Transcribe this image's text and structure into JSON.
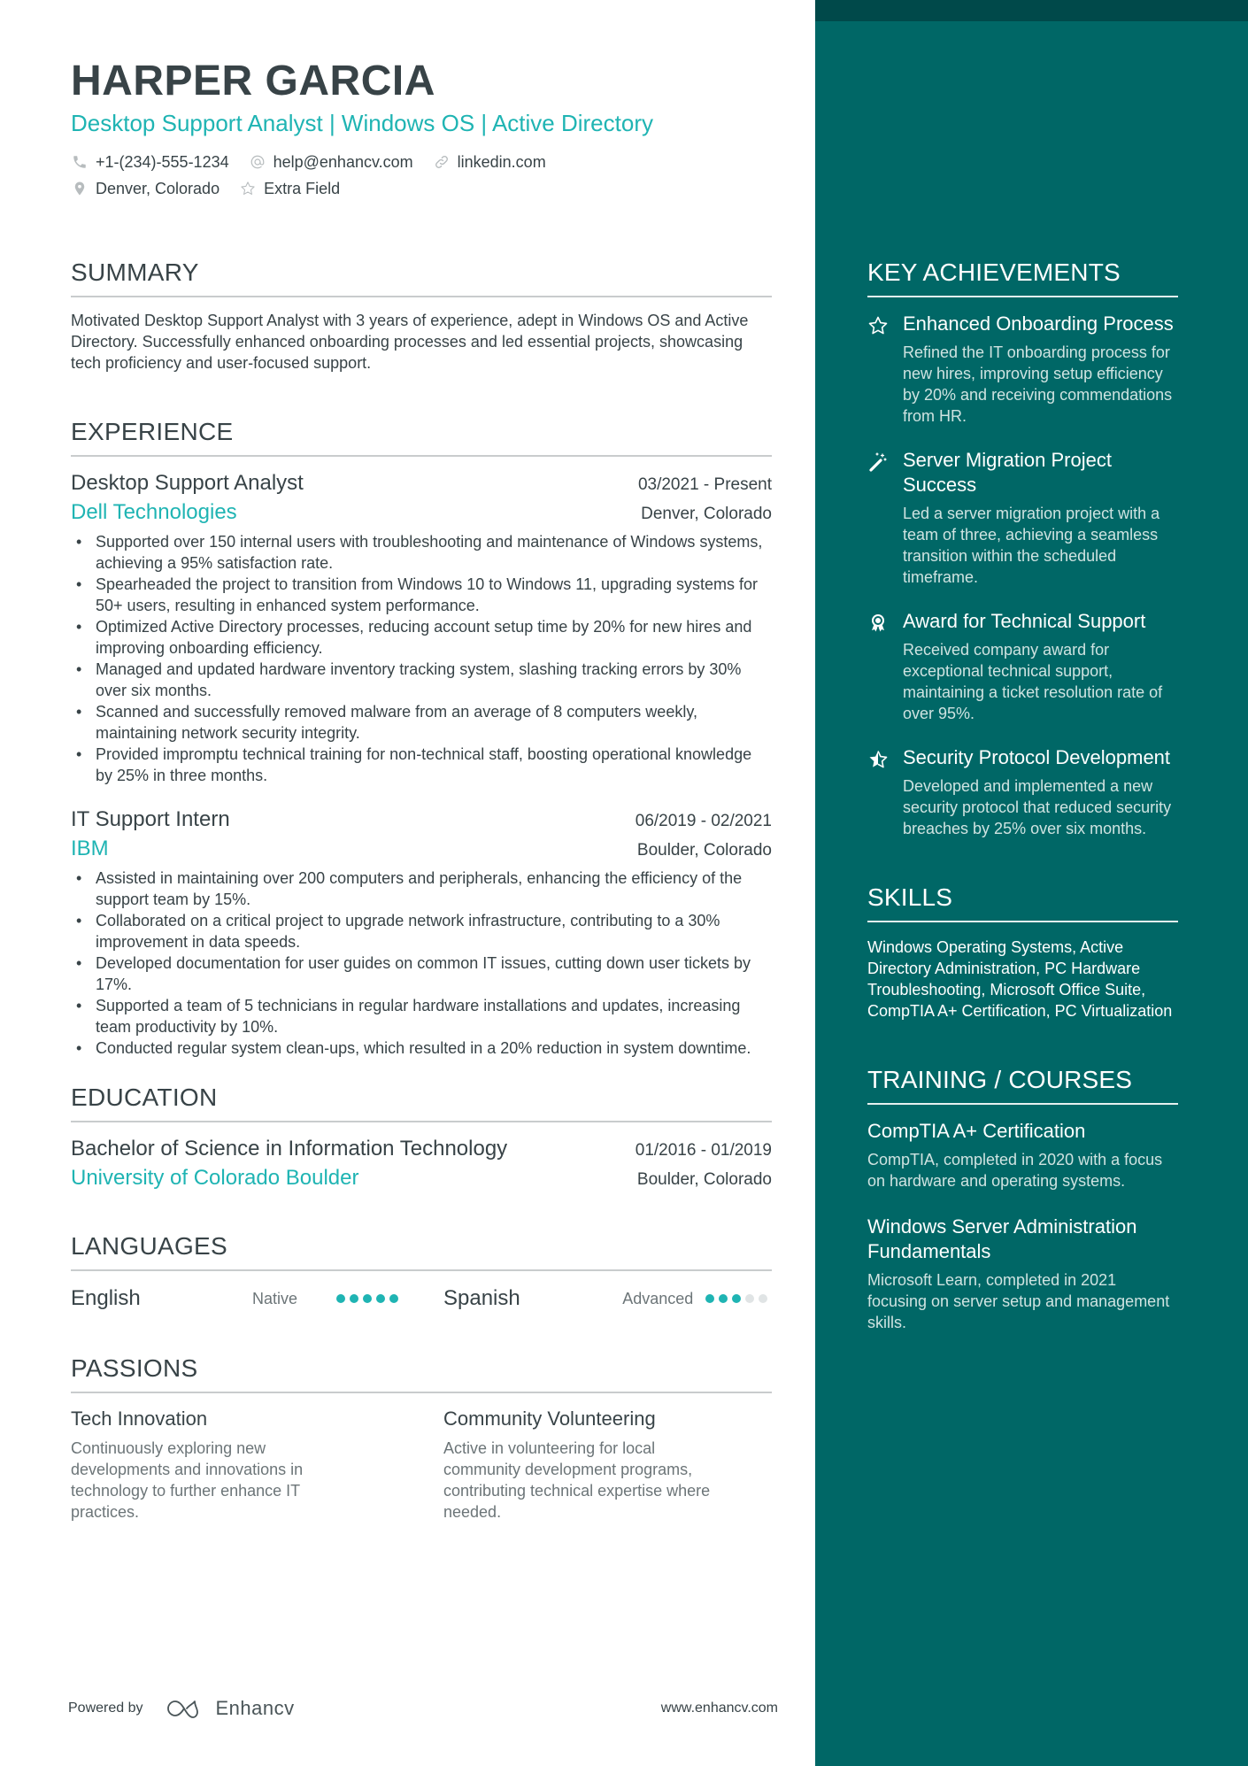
{
  "header": {
    "name": "HARPER GARCIA",
    "headline": "Desktop Support Analyst | Windows OS | Active Directory",
    "contacts": {
      "phone": "+1-(234)-555-1234",
      "email": "help@enhancv.com",
      "link": "linkedin.com",
      "location": "Denver, Colorado",
      "extra": "Extra Field"
    }
  },
  "summary": {
    "title": "SUMMARY",
    "text": "Motivated Desktop Support Analyst with 3 years of experience, adept in Windows OS and Active Directory. Successfully enhanced onboarding processes and led essential projects, showcasing tech proficiency and user-focused support."
  },
  "experience": {
    "title": "EXPERIENCE",
    "jobs": [
      {
        "title": "Desktop Support Analyst",
        "dates": "03/2021 - Present",
        "company": "Dell Technologies",
        "location": "Denver, Colorado",
        "bullets": [
          "Supported over 150 internal users with troubleshooting and maintenance of Windows systems, achieving a 95% satisfaction rate.",
          "Spearheaded the project to transition from Windows 10 to Windows 11, upgrading systems for 50+ users, resulting in enhanced system performance.",
          "Optimized Active Directory processes, reducing account setup time by 20% for new hires and improving onboarding efficiency.",
          "Managed and updated hardware inventory tracking system, slashing tracking errors by 30% over six months.",
          "Scanned and successfully removed malware from an average of 8 computers weekly, maintaining network security integrity.",
          "Provided impromptu technical training for non-technical staff, boosting operational knowledge by 25% in three months."
        ]
      },
      {
        "title": "IT Support Intern",
        "dates": "06/2019 - 02/2021",
        "company": "IBM",
        "location": "Boulder, Colorado",
        "bullets": [
          "Assisted in maintaining over 200 computers and peripherals, enhancing the efficiency of the support team by 15%.",
          "Collaborated on a critical project to upgrade network infrastructure, contributing to a 30% improvement in data speeds.",
          "Developed documentation for user guides on common IT issues, cutting down user tickets by 17%.",
          "Supported a team of 5 technicians in regular hardware installations and updates, increasing team productivity by 10%.",
          "Conducted regular system clean-ups, which resulted in a 20% reduction in system downtime."
        ]
      }
    ]
  },
  "education": {
    "title": "EDUCATION",
    "items": [
      {
        "degree": "Bachelor of Science in Information Technology",
        "dates": "01/2016 - 01/2019",
        "school": "University of Colorado Boulder",
        "location": "Boulder, Colorado"
      }
    ]
  },
  "languages": {
    "title": "LANGUAGES",
    "items": [
      {
        "name": "English",
        "level": "Native",
        "rating": 5,
        "max": 5
      },
      {
        "name": "Spanish",
        "level": "Advanced",
        "rating": 3,
        "max": 5
      }
    ]
  },
  "passions": {
    "title": "PASSIONS",
    "items": [
      {
        "title": "Tech Innovation",
        "desc": "Continuously exploring new developments and innovations in technology to further enhance IT practices."
      },
      {
        "title": "Community Volunteering",
        "desc": "Active in volunteering for local community development programs, contributing technical expertise where needed."
      }
    ]
  },
  "sidebar": {
    "achievements": {
      "title": "KEY ACHIEVEMENTS",
      "items": [
        {
          "icon": "star-icon",
          "title": "Enhanced Onboarding Process",
          "desc": "Refined the IT onboarding process for new hires, improving setup efficiency by 20% and receiving commendations from HR."
        },
        {
          "icon": "magic-wand-icon",
          "title": "Server Migration Project Success",
          "desc": "Led a server migration project with a team of three, achieving a seamless transition within the scheduled timeframe."
        },
        {
          "icon": "award-ribbon-icon",
          "title": "Award for Technical Support",
          "desc": "Received company award for exceptional technical support, maintaining a ticket resolution rate of over 95%."
        },
        {
          "icon": "half-star-icon",
          "title": "Security Protocol Development",
          "desc": "Developed and implemented a new security protocol that reduced security breaches by 25% over six months."
        }
      ]
    },
    "skills": {
      "title": "SKILLS",
      "text": "Windows Operating Systems, Active Directory Administration, PC Hardware Troubleshooting, Microsoft Office Suite, CompTIA A+ Certification, PC Virtualization"
    },
    "training": {
      "title": "TRAINING / COURSES",
      "items": [
        {
          "title": "CompTIA A+ Certification",
          "desc": "CompTIA, completed in 2020 with a focus on hardware and operating systems."
        },
        {
          "title": "Windows Server Administration Fundamentals",
          "desc": "Microsoft Learn, completed in 2021 focusing on server setup and management skills."
        }
      ]
    }
  },
  "footer": {
    "powered_by": "Powered by",
    "brand": "Enhancv",
    "website": "www.enhancv.com"
  },
  "colors": {
    "accent": "#1fb4b3",
    "sidebar": "#006766",
    "sidebar_band": "#00494a",
    "text": "#384347",
    "muted": "#6c7578"
  }
}
